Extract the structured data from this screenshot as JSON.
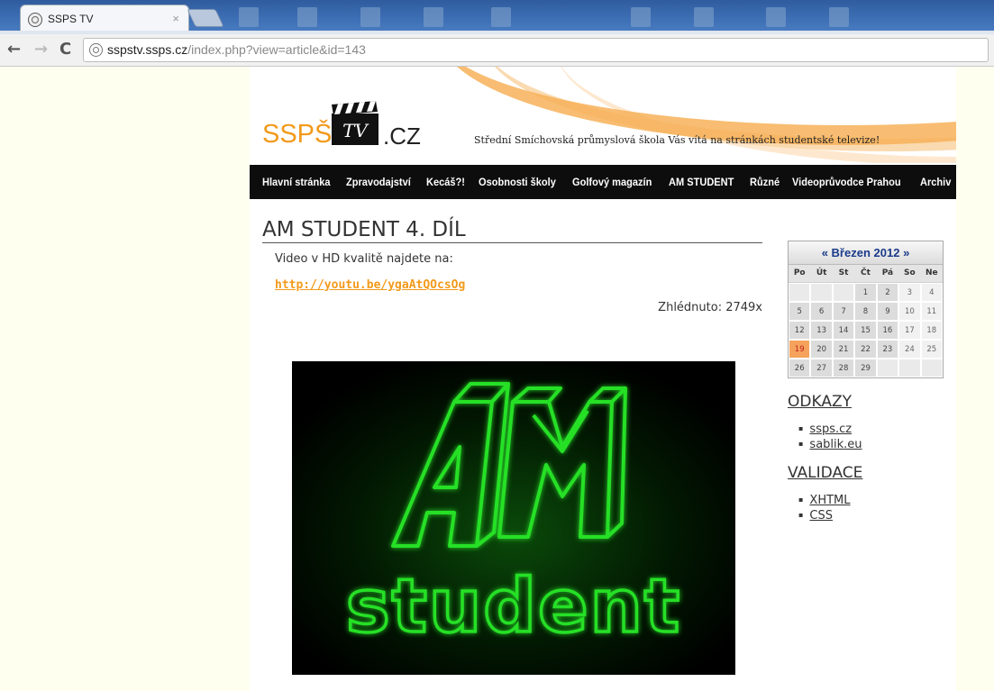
{
  "browser": {
    "tab_title": "SSPS TV",
    "tab_close": "×",
    "url_host": "sspstv.ssps.cz",
    "url_path": "/index.php?view=article&id=143"
  },
  "header": {
    "logo_ssps": "SSPŠ",
    "logo_tv": "TV",
    "logo_cz": ".CZ",
    "tagline": "Střední Smíchovská průmyslová škola Vás vítá na stránkách studentské televize!"
  },
  "nav": [
    "Hlavní stránka",
    "Zpravodajství",
    "Kecáš?!",
    "Osobnosti školy",
    "Golfový magazín",
    "AM STUDENT",
    "Různé",
    "Videoprůvodce Prahou",
    "Archiv"
  ],
  "article": {
    "title": "AM STUDENT 4. DÍL",
    "intro": "Video v HD kvalitě najdete na:",
    "link": "http://youtu.be/ygaAtQOcsOg",
    "views": "Zhlédnuto: 2749x",
    "video_text_top": "AM",
    "video_text_bottom": "student",
    "video_color": "#25e025"
  },
  "calendar": {
    "prev": "«",
    "month": "Březen 2012",
    "next": "»",
    "days": [
      "Po",
      "Út",
      "St",
      "Čt",
      "Pá",
      "So",
      "Ne"
    ],
    "weeks": [
      [
        "",
        "",
        "",
        "1",
        "2",
        "3",
        "4"
      ],
      [
        "5",
        "6",
        "7",
        "8",
        "9",
        "10",
        "11"
      ],
      [
        "12",
        "13",
        "14",
        "15",
        "16",
        "17",
        "18"
      ],
      [
        "19",
        "20",
        "21",
        "22",
        "23",
        "24",
        "25"
      ],
      [
        "26",
        "27",
        "28",
        "29",
        "",
        "",
        ""
      ]
    ],
    "today": "19",
    "today_color": "#f5a35c"
  },
  "sidebar": {
    "links_heading": "ODKAZY",
    "links": [
      "ssps.cz",
      "sablik.eu"
    ],
    "validation_heading": "VALIDACE",
    "validation": [
      "XHTML",
      "CSS"
    ]
  },
  "colors": {
    "accent": "#f29a1b",
    "nav_bg": "#0d0d0d",
    "page_bg": "#fffff0"
  }
}
